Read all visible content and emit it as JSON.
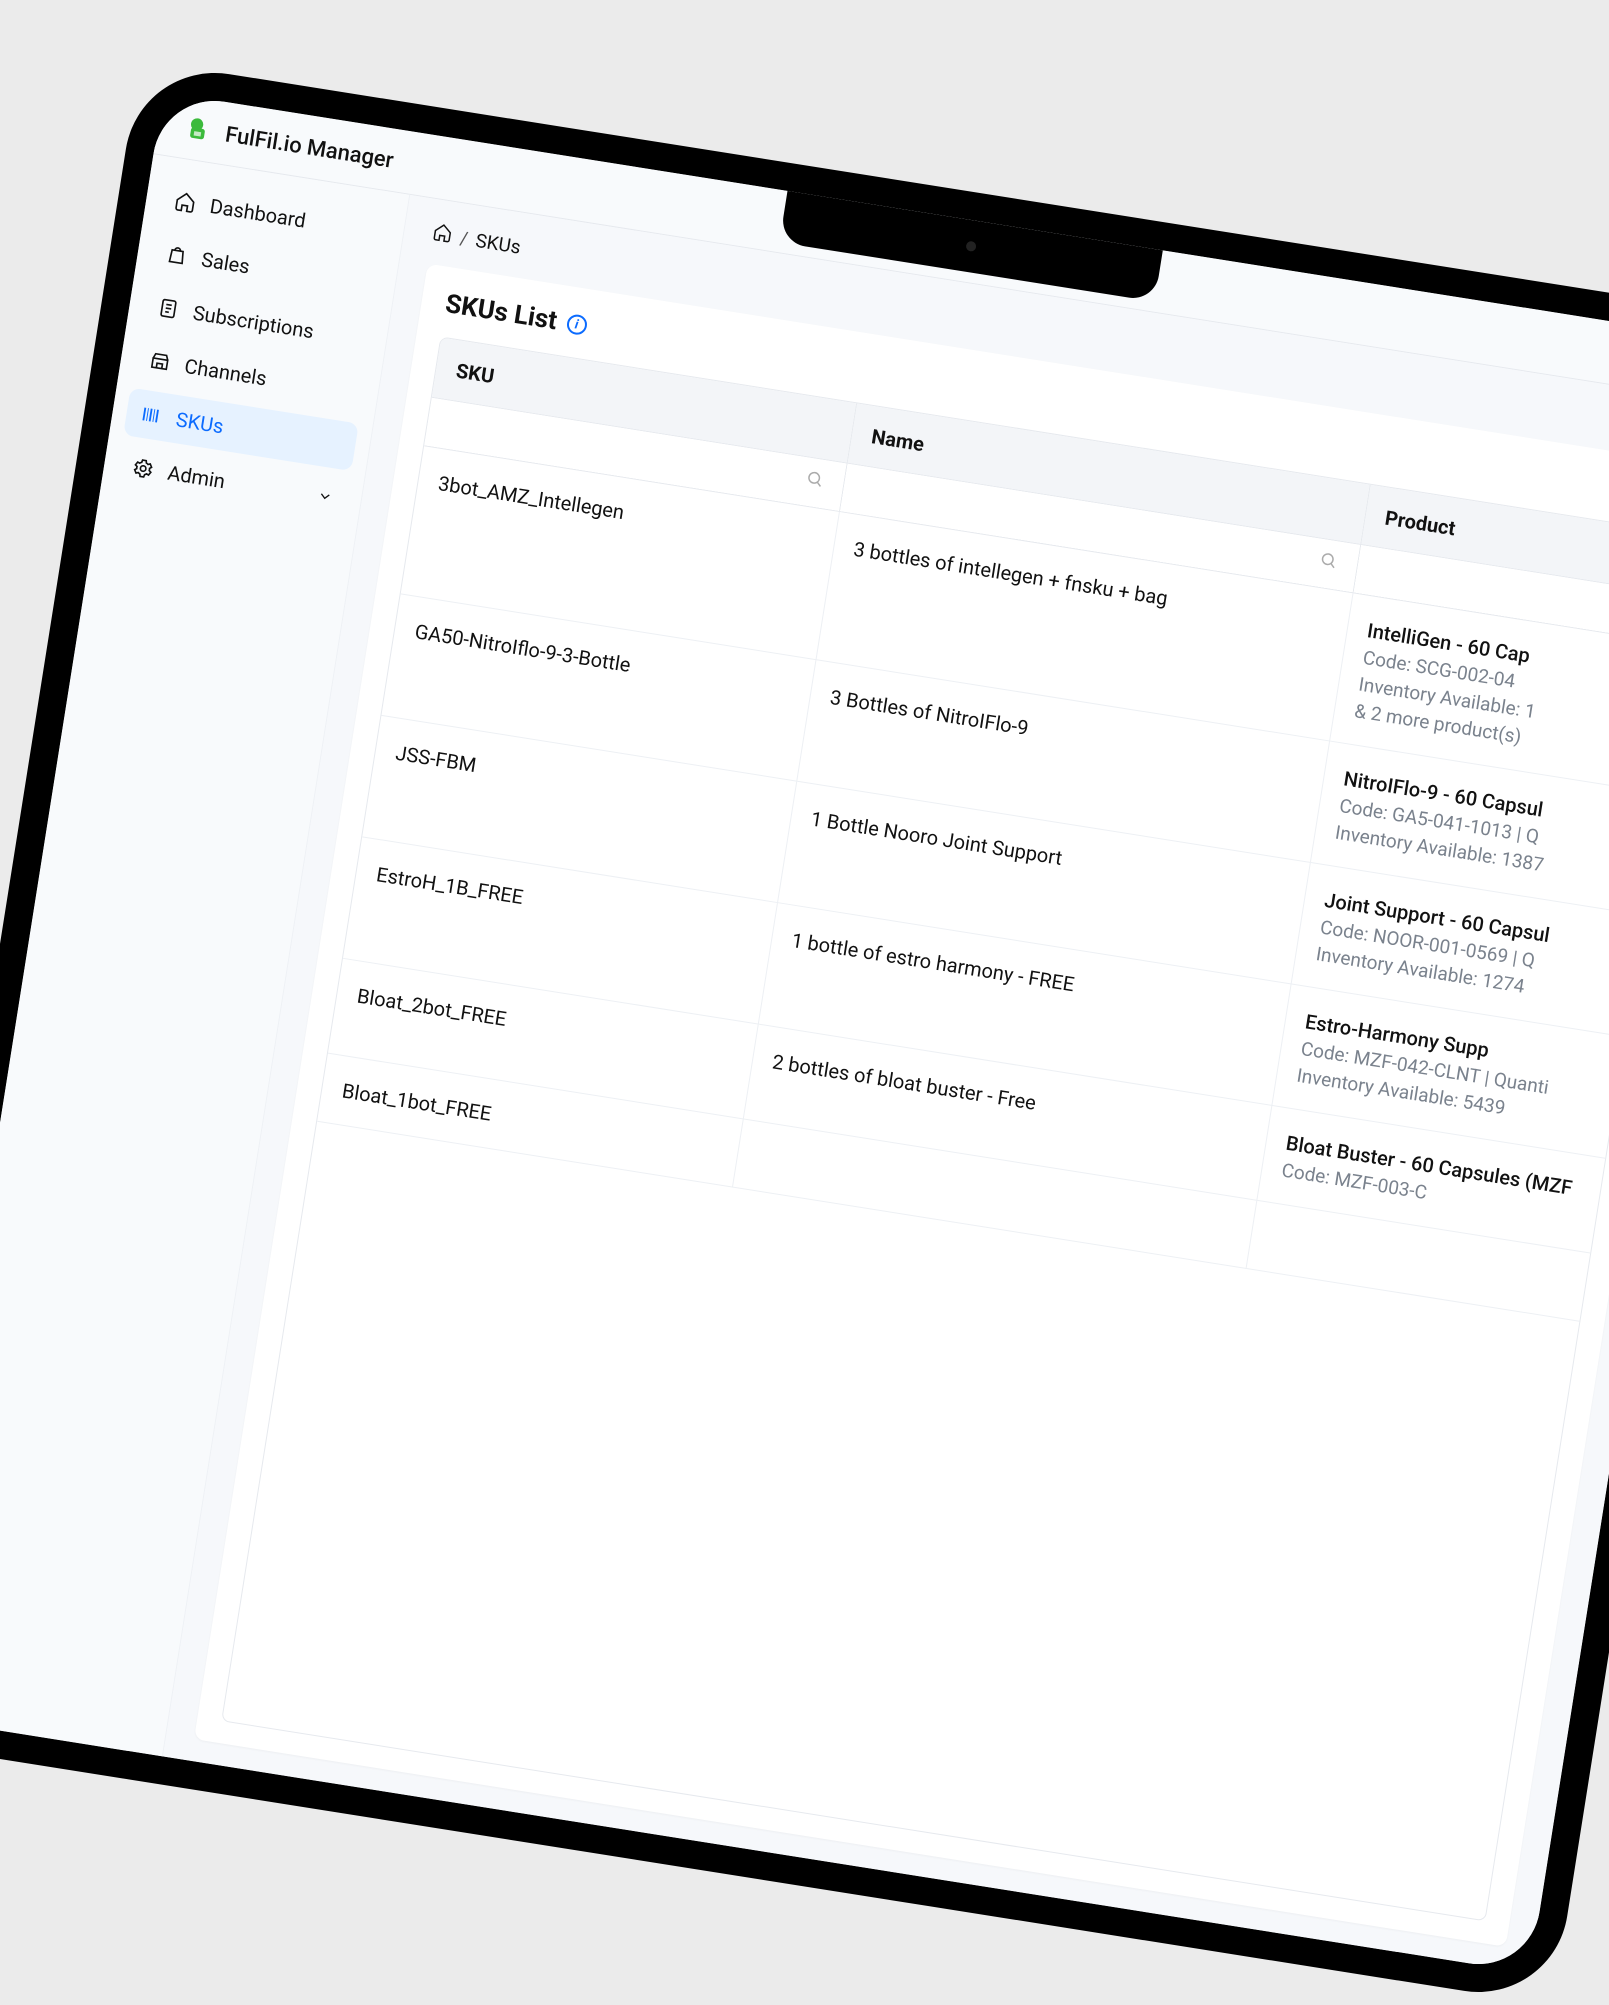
{
  "app": {
    "title": "FulFil.io Manager"
  },
  "sidebar": {
    "items": [
      {
        "label": "Dashboard"
      },
      {
        "label": "Sales"
      },
      {
        "label": "Subscriptions"
      },
      {
        "label": "Channels"
      },
      {
        "label": "SKUs"
      },
      {
        "label": "Admin"
      }
    ]
  },
  "breadcrumb": {
    "sep": "/",
    "current": "SKUs"
  },
  "page": {
    "title": "SKUs List"
  },
  "table": {
    "columns": {
      "sku": "SKU",
      "name": "Name",
      "product": "Product"
    },
    "rows": [
      {
        "sku": "3bot_AMZ_Intellegen",
        "name": "3 bottles of intellegen + fnsku + bag",
        "product": {
          "title": "IntelliGen - 60 Cap",
          "line2": "Code: SCG-002-04",
          "line3": "Inventory Available: 1",
          "line4": "& 2 more product(s)"
        }
      },
      {
        "sku": "GA50-NitroIflo-9-3-Bottle",
        "name": "3 Bottles of NitroIFlo-9",
        "product": {
          "title": "NitroIFlo-9 - 60 Capsul",
          "line2": "Code: GA5-041-1013 | Q",
          "line3": "Inventory Available: 1387",
          "line4": ""
        }
      },
      {
        "sku": "JSS-FBM",
        "name": "1 Bottle Nooro Joint Support",
        "product": {
          "title": "Joint Support - 60 Capsul",
          "line2": "Code: NOOR-001-0569 | Q",
          "line3": "Inventory Available: 1274",
          "line4": ""
        }
      },
      {
        "sku": "EstroH_1B_FREE",
        "name": "1 bottle of estro harmony - FREE",
        "product": {
          "title": "Estro-Harmony Supp",
          "line2": "Code: MZF-042-CLNT | Quanti",
          "line3": "Inventory Available: 5439",
          "line4": ""
        }
      },
      {
        "sku": "Bloat_2bot_FREE",
        "name": "2 bottles of bloat buster - Free",
        "product": {
          "title": "Bloat Buster - 60 Capsules (MZF",
          "line2": "Code: MZF-003-C",
          "line3": "",
          "line4": ""
        }
      },
      {
        "sku": "Bloat_1bot_FREE",
        "name": "",
        "product": {
          "title": "",
          "line2": "",
          "line3": "",
          "line4": ""
        }
      }
    ]
  }
}
